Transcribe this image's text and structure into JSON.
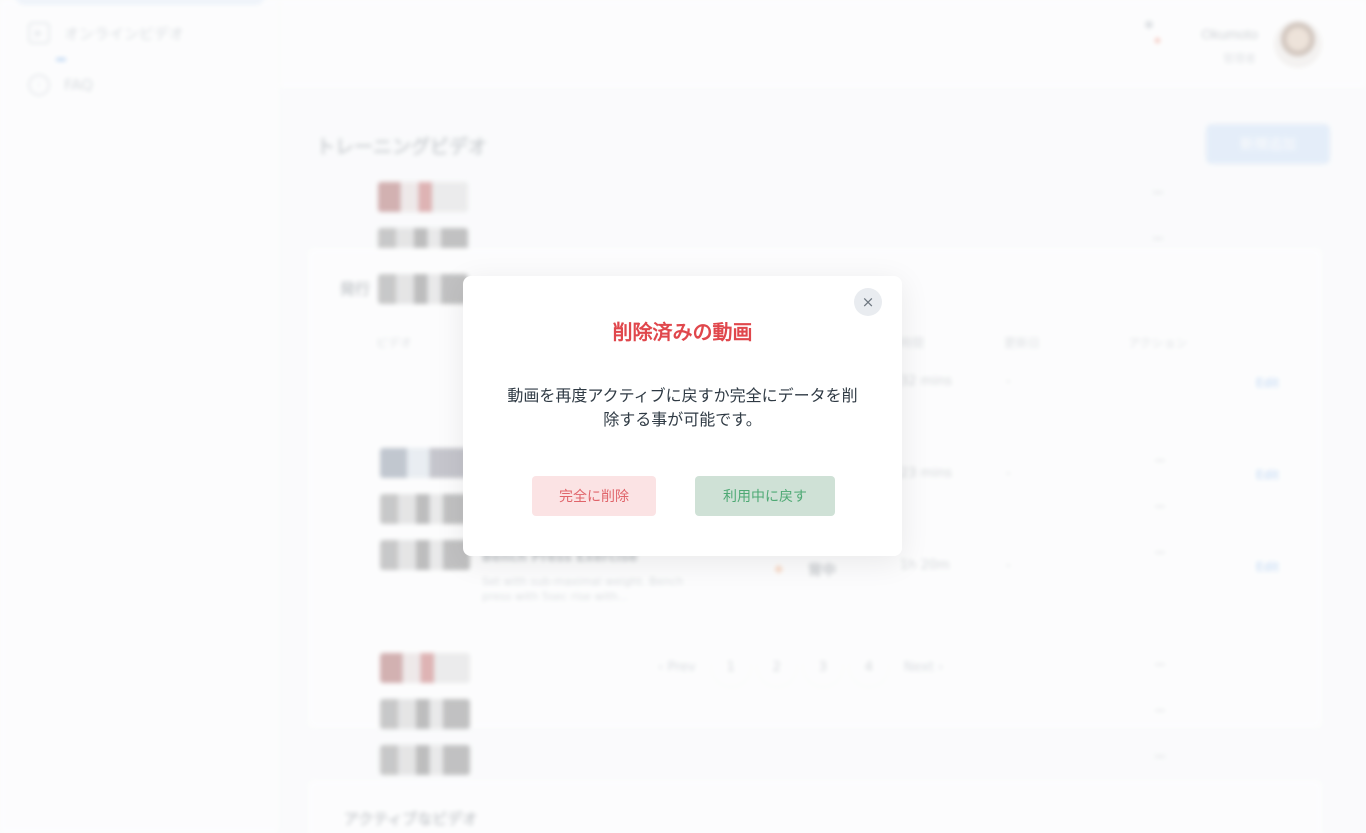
{
  "sidebar": {
    "items": [
      {
        "label": "オンラインビデオ",
        "icon": "play-icon"
      },
      {
        "label": "FAQ",
        "icon": "info-icon"
      }
    ]
  },
  "topbar": {
    "user_name": "Okumoto",
    "user_role": "管理者"
  },
  "main": {
    "title": "トレーニングビデオ",
    "new_button": "新規追加",
    "section_published": "発行",
    "columns": [
      "ビデオ",
      "時間",
      "更新日",
      "アクション"
    ],
    "rows": [
      {
        "duration": "32 mins",
        "updated": "-",
        "action": "Edit"
      },
      {
        "duration": "23 mins",
        "updated": "-",
        "action": "Edit"
      },
      {
        "title": "Bench Press Exercise",
        "desc": "Set with sub-maximal weight. Bench press with 5sec rise with...",
        "status": "背中",
        "duration": "1h 20m",
        "updated": "-",
        "action": "Edit"
      }
    ],
    "pagination": {
      "prev": "‹ Prev",
      "pages": [
        "1",
        "2",
        "3",
        "4"
      ],
      "next": "Next ›"
    },
    "dash": "ー",
    "section_active": "アクティブなビデオ"
  },
  "modal": {
    "close_glyph": "×",
    "title": "削除済みの動画",
    "message": "動画を再度アクティブに戻すか完全にデータを削除する事が可能です。",
    "delete_button": "完全に削除",
    "restore_button": "利用中に戻す"
  },
  "colors": {
    "title_red": "#e0474c",
    "delete_bg": "#fbe3e4",
    "restore_bg": "#cfe1d6",
    "restore_text": "#4ea974"
  }
}
